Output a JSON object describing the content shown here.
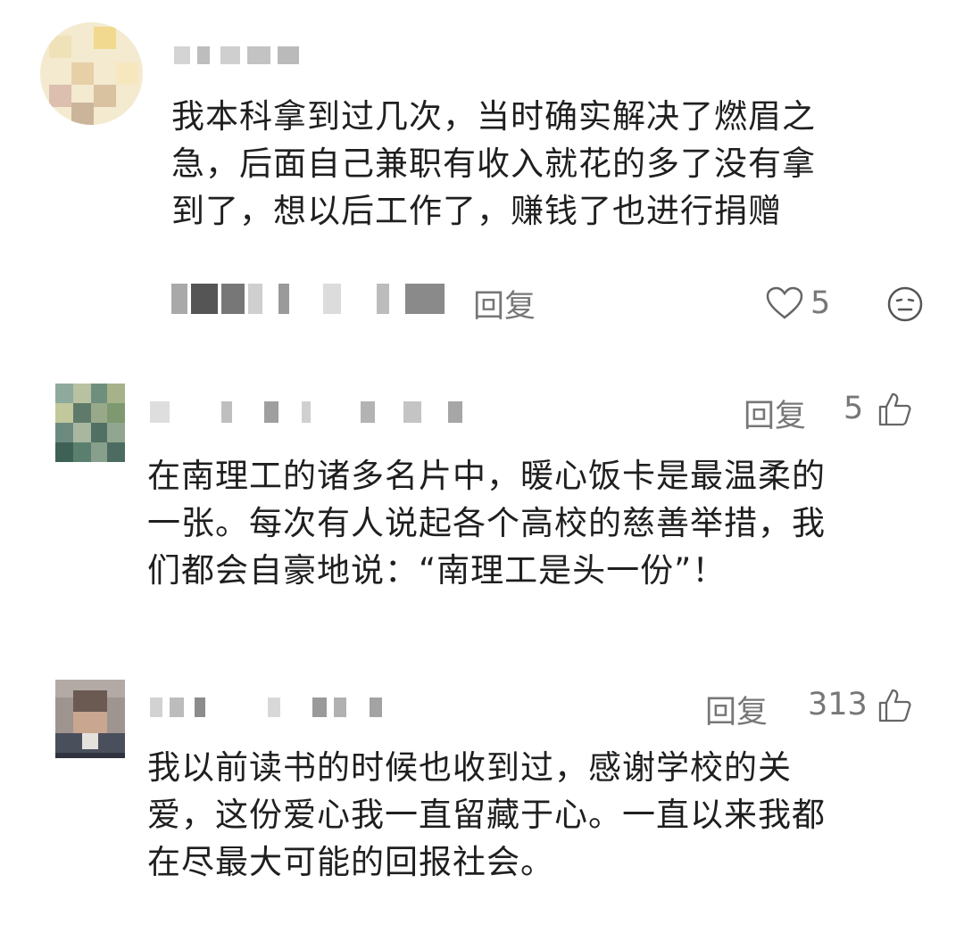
{
  "comments": [
    {
      "text_lines": [
        "我本科拿到过几次，当时确实解决了燃眉之",
        "急，后面自己兼职有收入就花的多了没有拿",
        "到了，想以后工作了，赚钱了也进行捐赠"
      ],
      "reply_label": "回复",
      "likes": "5",
      "icons": {
        "like": "heart-icon",
        "extra": "neutral-face-icon"
      }
    },
    {
      "text_lines": [
        "在南理工的诸多名片中，暖心饭卡是最温柔的",
        "一张。每次有人说起各个高校的慈善举措，我",
        "们都会自豪地说：“南理工是头一份”！"
      ],
      "reply_label": "回复",
      "likes": "5",
      "icons": {
        "like": "thumbs-up-icon"
      }
    },
    {
      "text_lines": [
        "我以前读书的时候也收到过，感谢学校的关",
        "爱，这份爱心我一直留藏于心。一直以来我都",
        "在尽最大可能的回报社会。"
      ],
      "reply_label": "回复",
      "likes": "313",
      "icons": {
        "like": "thumbs-up-icon"
      }
    }
  ],
  "colors": {
    "text": "#1f1f1f",
    "secondary": "#777777",
    "blur": "#c9c9c9"
  }
}
